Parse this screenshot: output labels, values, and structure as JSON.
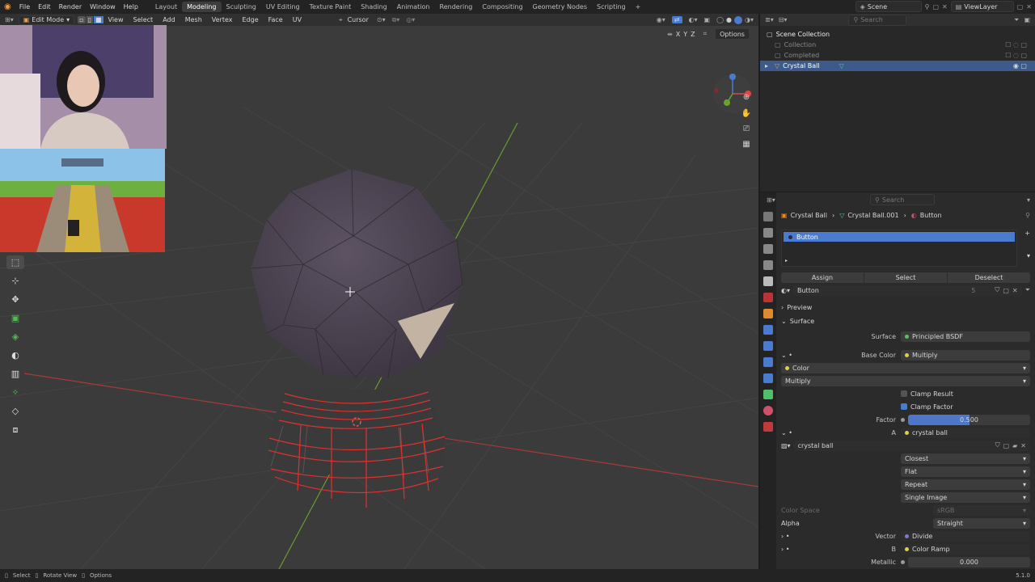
{
  "menu": [
    "File",
    "Edit",
    "Render",
    "Window",
    "Help"
  ],
  "workspaces": [
    "Layout",
    "Modeling",
    "Sculpting",
    "UV Editing",
    "Texture Paint",
    "Shading",
    "Animation",
    "Rendering",
    "Compositing",
    "Geometry Nodes",
    "Scripting"
  ],
  "active_workspace": "Modeling",
  "scene": "Scene",
  "view_layer": "ViewLayer",
  "viewport_header": {
    "mode": "Edit Mode",
    "menus": [
      "View",
      "Select",
      "Add",
      "Mesh",
      "Vertex",
      "Edge",
      "Face",
      "UV"
    ],
    "transform_pivot": "Cursor",
    "options": "Options",
    "axes": [
      "X",
      "Y",
      "Z"
    ]
  },
  "outliner": {
    "search_placeholder": "Search",
    "root": "Scene Collection",
    "items": [
      "Collection",
      "Completed",
      "Crystal Ball"
    ]
  },
  "properties": {
    "search_placeholder": "Search",
    "breadcrumb": [
      "Crystal Ball",
      "Crystal Ball.001",
      "Button"
    ],
    "material_slot": "Button",
    "assign": "Assign",
    "select": "Select",
    "deselect": "Deselect",
    "material_name": "Button",
    "material_users": "5",
    "preview": "Preview",
    "surface_section": "Surface",
    "surface_label": "Surface",
    "surface_value": "Principled BSDF",
    "base_color_label": "Base Color",
    "base_color_value": "Multiply",
    "color_label": "Color",
    "blend_mode": "Multiply",
    "clamp_result": "Clamp Result",
    "clamp_factor": "Clamp Factor",
    "factor_label": "Factor",
    "factor_value": "0.500",
    "factor_fraction": 0.5,
    "a_label": "A",
    "a_value": "crystal ball",
    "image_name": "crystal ball",
    "interpolation": "Closest",
    "projection": "Flat",
    "extension": "Repeat",
    "source": "Single Image",
    "color_space_label": "Color Space",
    "color_space_value": "sRGB",
    "alpha_label": "Alpha",
    "alpha_value": "Straight",
    "vector_label": "Vector",
    "vector_value": "Divide",
    "b_label": "B",
    "b_value": "Color Ramp",
    "metallic_label": "Metallic",
    "metallic_value": "0.000"
  },
  "statusbar": {
    "select": "Select",
    "rotate": "Rotate View",
    "options": "Options",
    "version": "5.1.0"
  },
  "colors": {
    "accent": "#4a7bcf",
    "selection_row": "#3e5a8a",
    "edge_select": "#e8322f",
    "factor_bar": "#4f77c9"
  }
}
